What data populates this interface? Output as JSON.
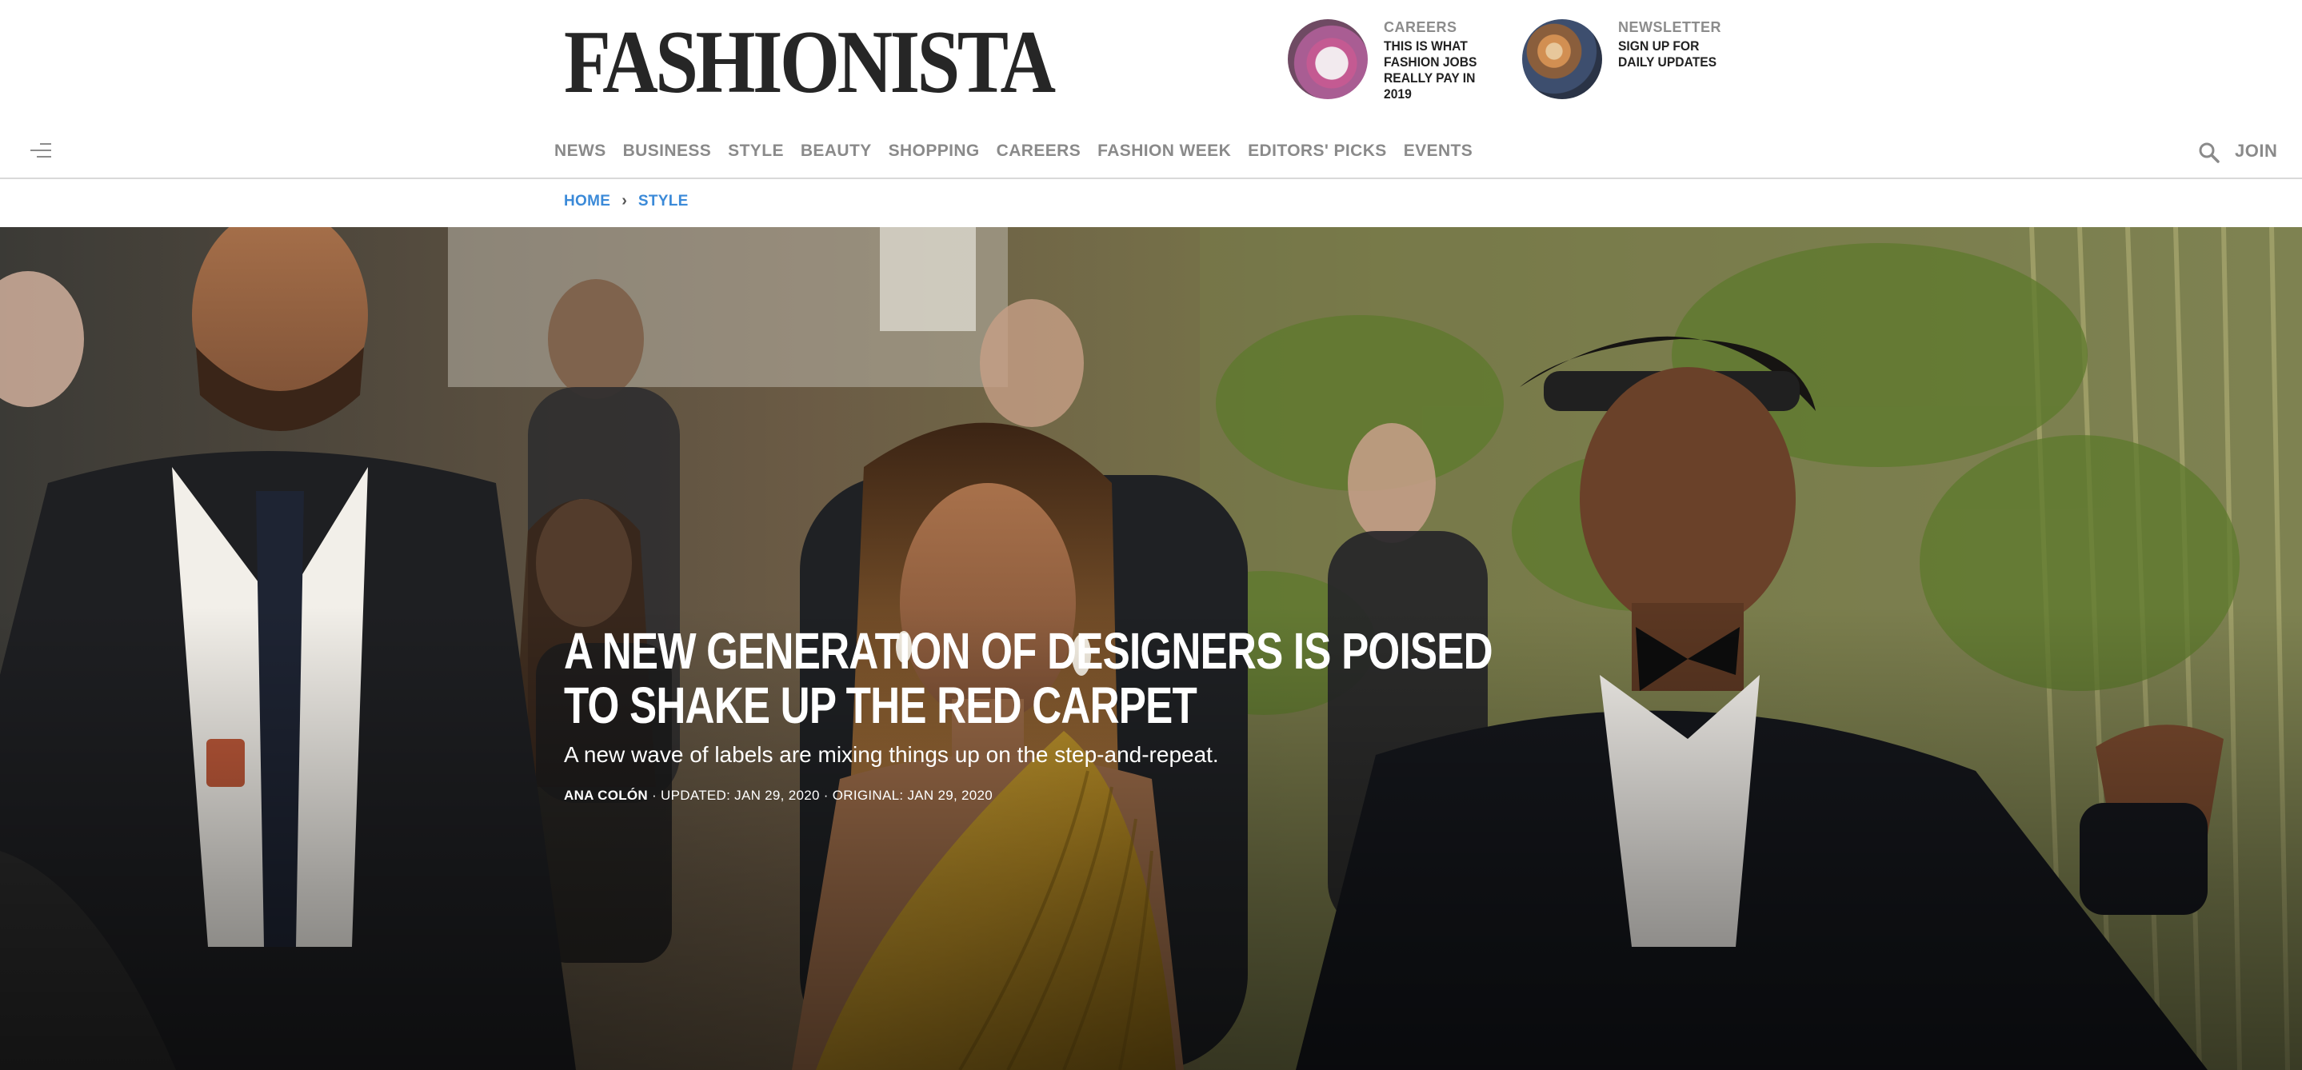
{
  "site": {
    "logo": "FASHIONISTA"
  },
  "promos": [
    {
      "kicker": "CAREERS",
      "blurb": "THIS IS WHAT FASHION JOBS REALLY PAY IN 2019"
    },
    {
      "kicker": "NEWSLETTER",
      "blurb": "SIGN UP FOR DAILY UPDATES"
    }
  ],
  "nav": {
    "items": [
      "NEWS",
      "BUSINESS",
      "STYLE",
      "BEAUTY",
      "SHOPPING",
      "CAREERS",
      "FASHION WEEK",
      "EDITORS' PICKS",
      "EVENTS"
    ],
    "join": "JOIN",
    "icons": [
      "menu-icon",
      "search-icon"
    ]
  },
  "breadcrumb": {
    "home": "HOME",
    "separator": "›",
    "section": "STYLE"
  },
  "article": {
    "headline": "A NEW GENERATION OF DESIGNERS IS POISED TO SHAKE UP THE RED CARPET",
    "dek": "A new wave of labels are mixing things up on the step-and-repeat.",
    "author": "ANA COLÓN",
    "meta": " · UPDATED: JAN 29, 2020 · ORIGINAL: JAN 29, 2020"
  },
  "colors": {
    "logo": "#262626",
    "nav_text": "#8a8a8a",
    "breadcrumb_link": "#3b8ad8",
    "hero_text": "#ffffff"
  }
}
